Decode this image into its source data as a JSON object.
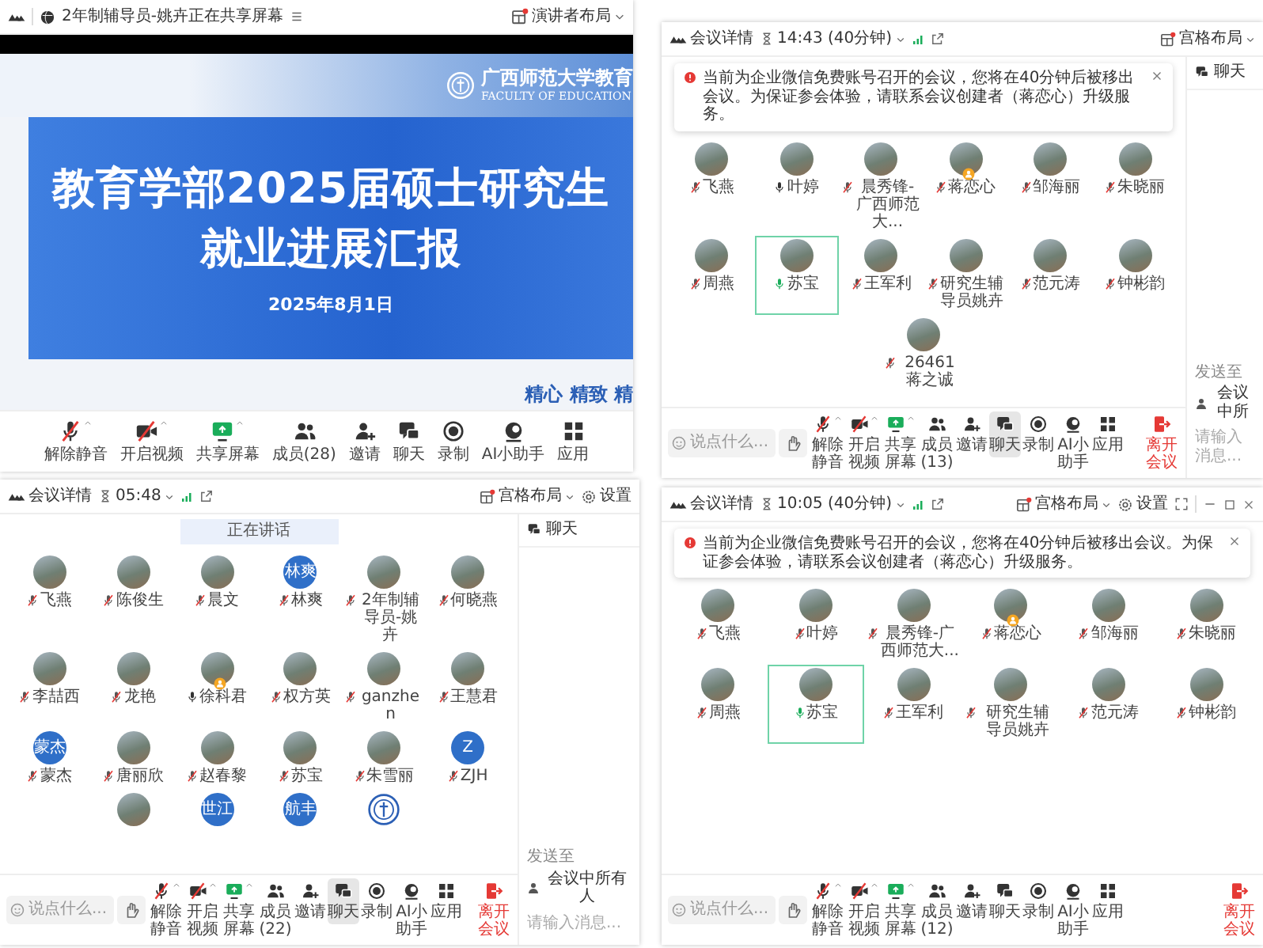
{
  "screens": [
    {
      "kind": "presentation",
      "header": {
        "title": "2年制辅导员-姚卉正在共享屏幕",
        "layout": "演讲者布局"
      },
      "slide": {
        "school": "广西师范大学教育",
        "school_en": "FACULTY OF EDUCATION",
        "title_lines": [
          "教育学部2025届硕士研究生",
          "就业进展汇报"
        ],
        "date": "2025年8月1日",
        "motto": "精心 精致 精"
      },
      "toolbar": [
        {
          "kind": "mic",
          "label": "解除静音",
          "selected": false
        },
        {
          "kind": "video",
          "label": "开启视频",
          "selected": false
        },
        {
          "kind": "share",
          "label": "共享屏幕",
          "selected": false
        },
        {
          "kind": "members",
          "label": "成员(28)",
          "selected": false
        },
        {
          "kind": "invite",
          "label": "邀请",
          "selected": false
        },
        {
          "kind": "chat",
          "label": "聊天",
          "selected": false
        },
        {
          "kind": "record",
          "label": "录制",
          "selected": false
        },
        {
          "kind": "ai",
          "label": "AI小助手",
          "selected": false
        },
        {
          "kind": "apps",
          "label": "应用",
          "selected": false
        }
      ]
    },
    {
      "kind": "gallery",
      "header": {
        "details": "会议详情",
        "time": "14:43 (40分钟)",
        "layout": "宫格布局"
      },
      "notice": "当前为企业微信免费账号召开的会议，您将在40分钟后被移出会议。为保证参会体验，请联系会议创建者（蒋恋心）升级服务。",
      "participants": [
        {
          "name": "飞燕",
          "kind": "photo",
          "muted": true,
          "speaking": false,
          "host": false
        },
        {
          "name": "叶婷",
          "kind": "photo",
          "muted": false,
          "speaking": false,
          "host": false
        },
        {
          "name": "晨秀锋-广西师范大...",
          "kind": "photo",
          "muted": true,
          "speaking": false,
          "host": false
        },
        {
          "name": "蒋恋心",
          "kind": "photo",
          "muted": true,
          "speaking": false,
          "host": true
        },
        {
          "name": "邹海丽",
          "kind": "photo",
          "muted": true,
          "speaking": false,
          "host": false
        },
        {
          "name": "朱晓丽",
          "kind": "photo",
          "muted": true,
          "speaking": false,
          "host": false
        },
        {
          "name": "周燕",
          "kind": "photo",
          "muted": true,
          "speaking": false,
          "host": false
        },
        {
          "name": "苏宝",
          "kind": "photo",
          "muted": false,
          "speaking": true,
          "host": false
        },
        {
          "name": "王军利",
          "kind": "photo",
          "muted": true,
          "speaking": false,
          "host": false
        },
        {
          "name": "研究生辅导员姚卉",
          "kind": "photo",
          "muted": true,
          "speaking": false,
          "host": false
        },
        {
          "name": "范元涛",
          "kind": "photo",
          "muted": true,
          "speaking": false,
          "host": false
        },
        {
          "name": "钟彬韵",
          "kind": "photo",
          "muted": true,
          "speaking": false,
          "host": false
        },
        {
          "name": "26461蒋之诚",
          "kind": "photo",
          "muted": true,
          "speaking": false,
          "host": false
        }
      ],
      "input_placeholder": "说点什么...",
      "toolbar": [
        {
          "kind": "mic",
          "label": "解除静音",
          "selected": false
        },
        {
          "kind": "video",
          "label": "开启视频",
          "selected": false
        },
        {
          "kind": "share",
          "label": "共享屏幕",
          "selected": false
        },
        {
          "kind": "members",
          "label": "成员(13)",
          "selected": false
        },
        {
          "kind": "invite",
          "label": "邀请",
          "selected": false
        },
        {
          "kind": "chat",
          "label": "聊天",
          "selected": true
        },
        {
          "kind": "record",
          "label": "录制",
          "selected": false
        },
        {
          "kind": "ai",
          "label": "AI小助手",
          "selected": false
        },
        {
          "kind": "apps",
          "label": "应用",
          "selected": false
        },
        {
          "kind": "leave",
          "label": "离开会议",
          "selected": false
        }
      ],
      "chat": {
        "title": "聊天",
        "send_to": "发送至",
        "recipient": "会议中所",
        "placeholder": "请输入消息..."
      }
    },
    {
      "kind": "gallery",
      "header": {
        "details": "会议详情",
        "time": "05:48",
        "layout": "宫格布局",
        "settings": "设置"
      },
      "speaking_banner": "正在讲话",
      "participants": [
        {
          "name": "飞燕",
          "kind": "photo",
          "muted": true,
          "speaking": false,
          "host": false
        },
        {
          "name": "陈俊生",
          "kind": "photo",
          "muted": true,
          "speaking": false,
          "host": false
        },
        {
          "name": "晨文",
          "kind": "photo",
          "muted": true,
          "speaking": false,
          "host": false
        },
        {
          "name": "林爽",
          "kind": "initials",
          "initials": "林爽",
          "muted": true,
          "speaking": false,
          "host": false
        },
        {
          "name": "2年制辅导员-姚卉",
          "kind": "photo",
          "muted": true,
          "speaking": false,
          "host": false
        },
        {
          "name": "何晓燕",
          "kind": "photo",
          "muted": true,
          "speaking": false,
          "host": false
        },
        {
          "name": "李喆西",
          "kind": "photo",
          "muted": true,
          "speaking": false,
          "host": false
        },
        {
          "name": "龙艳",
          "kind": "photo",
          "muted": true,
          "speaking": false,
          "host": false
        },
        {
          "name": "徐科君",
          "kind": "photo",
          "muted": false,
          "speaking": false,
          "host": true
        },
        {
          "name": "权方英",
          "kind": "photo",
          "muted": true,
          "speaking": false,
          "host": false
        },
        {
          "name": "ganzhen",
          "kind": "photo",
          "muted": true,
          "speaking": false,
          "host": false
        },
        {
          "name": "王慧君",
          "kind": "photo",
          "muted": true,
          "speaking": false,
          "host": false
        },
        {
          "name": "蒙杰",
          "kind": "initials",
          "initials": "蒙杰",
          "muted": true,
          "speaking": false,
          "host": false
        },
        {
          "name": "唐丽欣",
          "kind": "photo",
          "muted": true,
          "speaking": false,
          "host": false
        },
        {
          "name": "赵春黎",
          "kind": "photo",
          "muted": true,
          "speaking": false,
          "host": false
        },
        {
          "name": "苏宝",
          "kind": "photo",
          "muted": true,
          "speaking": false,
          "host": false
        },
        {
          "name": "朱雪丽",
          "kind": "photo",
          "muted": true,
          "speaking": false,
          "host": false
        },
        {
          "name": "ZJH",
          "kind": "initials",
          "initials": "Z",
          "muted": true,
          "speaking": false,
          "host": false
        },
        {
          "kind": "photo",
          "speaking": false,
          "host": false
        },
        {
          "kind": "initials",
          "initials": "世江",
          "speaking": false,
          "host": false
        },
        {
          "kind": "initials",
          "initials": "航丰",
          "speaking": false,
          "host": false
        },
        {
          "kind": "emblem",
          "speaking": false,
          "host": false
        }
      ],
      "input_placeholder": "说点什么...",
      "toolbar": [
        {
          "kind": "mic",
          "label": "解除静音",
          "selected": false
        },
        {
          "kind": "video",
          "label": "开启视频",
          "selected": false
        },
        {
          "kind": "share",
          "label": "共享屏幕",
          "selected": false
        },
        {
          "kind": "members",
          "label": "成员(22)",
          "selected": false
        },
        {
          "kind": "invite",
          "label": "邀请",
          "selected": false
        },
        {
          "kind": "chat",
          "label": "聊天",
          "selected": true
        },
        {
          "kind": "record",
          "label": "录制",
          "selected": false
        },
        {
          "kind": "ai",
          "label": "AI小助手",
          "selected": false
        },
        {
          "kind": "apps",
          "label": "应用",
          "selected": false
        },
        {
          "kind": "leave",
          "label": "离开会议",
          "selected": false
        }
      ],
      "chat": {
        "title": "聊天",
        "send_to": "发送至",
        "recipient": "会议中所有人",
        "placeholder": "请输入消息..."
      }
    },
    {
      "kind": "gallery",
      "header": {
        "details": "会议详情",
        "time": "10:05 (40分钟)",
        "layout": "宫格布局",
        "settings": "设置",
        "window_controls": true
      },
      "notice": "当前为企业微信免费账号召开的会议，您将在40分钟后被移出会议。为保证参会体验，请联系会议创建者（蒋恋心）升级服务。",
      "participants": [
        {
          "name": "飞燕",
          "kind": "photo",
          "muted": true,
          "speaking": false,
          "host": false
        },
        {
          "name": "叶婷",
          "kind": "photo",
          "muted": true,
          "speaking": false,
          "host": false
        },
        {
          "name": "晨秀锋-广西师范大...",
          "kind": "photo",
          "muted": true,
          "speaking": false,
          "host": false
        },
        {
          "name": "蒋恋心",
          "kind": "photo",
          "muted": true,
          "speaking": false,
          "host": true
        },
        {
          "name": "邹海丽",
          "kind": "photo",
          "muted": true,
          "speaking": false,
          "host": false
        },
        {
          "name": "朱晓丽",
          "kind": "photo",
          "muted": true,
          "speaking": false,
          "host": false
        },
        {
          "name": "周燕",
          "kind": "photo",
          "muted": true,
          "speaking": false,
          "host": false
        },
        {
          "name": "苏宝",
          "kind": "photo",
          "muted": false,
          "speaking": true,
          "host": false
        },
        {
          "name": "王军利",
          "kind": "photo",
          "muted": true,
          "speaking": false,
          "host": false
        },
        {
          "name": "研究生辅导员姚卉",
          "kind": "photo",
          "muted": true,
          "speaking": false,
          "host": false
        },
        {
          "name": "范元涛",
          "kind": "photo",
          "muted": true,
          "speaking": false,
          "host": false
        },
        {
          "name": "钟彬韵",
          "kind": "photo",
          "muted": true,
          "speaking": false,
          "host": false
        }
      ],
      "input_placeholder": "说点什么...",
      "toolbar": [
        {
          "kind": "mic",
          "label": "解除静音",
          "selected": false
        },
        {
          "kind": "video",
          "label": "开启视频",
          "selected": false
        },
        {
          "kind": "share",
          "label": "共享屏幕",
          "selected": false
        },
        {
          "kind": "members",
          "label": "成员(12)",
          "selected": false
        },
        {
          "kind": "invite",
          "label": "邀请",
          "selected": false
        },
        {
          "kind": "chat",
          "label": "聊天",
          "selected": false
        },
        {
          "kind": "record",
          "label": "录制",
          "selected": false
        },
        {
          "kind": "ai",
          "label": "AI小助手",
          "selected": false
        },
        {
          "kind": "apps",
          "label": "应用",
          "selected": false
        },
        {
          "kind": "leave",
          "label": "离开会议",
          "selected": false
        }
      ]
    }
  ]
}
